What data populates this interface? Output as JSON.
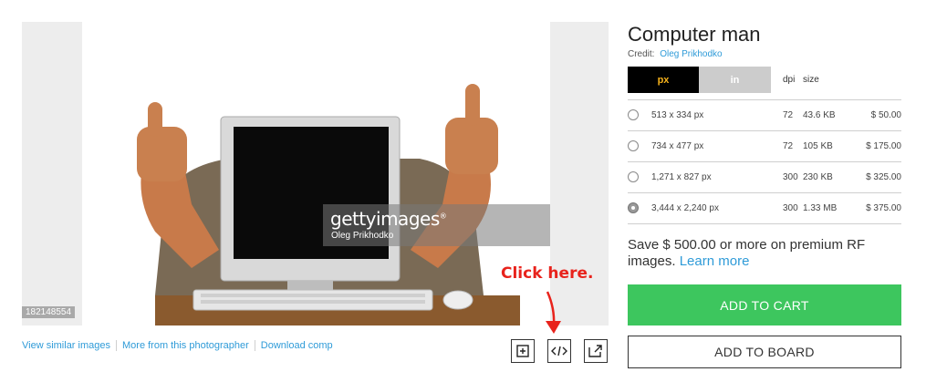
{
  "image": {
    "watermark_brand": "gettyimages",
    "watermark_credit": "Oleg Prikhodko",
    "image_id": "182148554"
  },
  "links": {
    "similar": "View similar images",
    "photographer": "More from this photographer",
    "download": "Download comp"
  },
  "toolbar": {
    "icons": [
      "add-to-board-icon",
      "embed-code-icon",
      "open-external-icon"
    ]
  },
  "annotation": {
    "text": "Click here.",
    "color": "#e8231c"
  },
  "details": {
    "title": "Computer man",
    "credit_label": "Credit:",
    "credit_name": "Oleg Prikhodko",
    "units": {
      "px": "px",
      "in": "in",
      "selected": "px"
    },
    "col_dpi": "dpi",
    "col_size": "size",
    "sizes": [
      {
        "dim": "513 x 334 px",
        "dpi": "72",
        "size": "43.6 KB",
        "price": "$ 50.00",
        "selected": false
      },
      {
        "dim": "734 x 477 px",
        "dpi": "72",
        "size": "105 KB",
        "price": "$ 175.00",
        "selected": false
      },
      {
        "dim": "1,271 x 827 px",
        "dpi": "300",
        "size": "230 KB",
        "price": "$ 325.00",
        "selected": false
      },
      {
        "dim": "3,444 x 2,240 px",
        "dpi": "300",
        "size": "1.33 MB",
        "price": "$ 375.00",
        "selected": true
      }
    ],
    "promo_text": "Save $ 500.00 or more on premium RF images.",
    "promo_link": "Learn more",
    "add_to_cart": "ADD TO CART",
    "add_to_board": "ADD TO BOARD"
  },
  "colors": {
    "accent_link": "#2f9bd8",
    "cart_green": "#3dc65e",
    "toggle_active_text": "#f6b21b"
  }
}
